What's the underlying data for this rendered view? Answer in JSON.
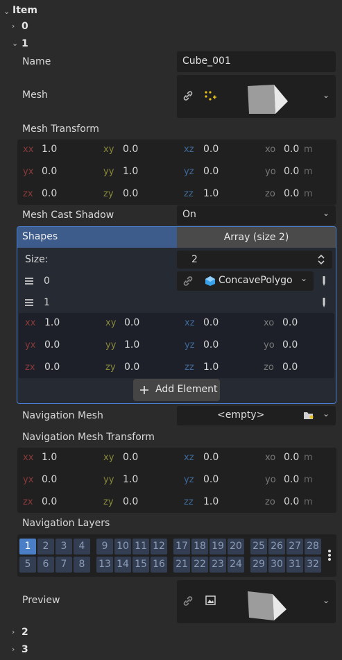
{
  "tree": {
    "item_label": "Item",
    "entries": [
      "0",
      "1",
      "2",
      "3"
    ]
  },
  "name": {
    "label": "Name",
    "value": "Cube_001"
  },
  "mesh": {
    "label": "Mesh"
  },
  "mesh_transform": {
    "label": "Mesh Transform",
    "rows": [
      {
        "a": "xx",
        "av": "1.0",
        "b": "xy",
        "bv": "0.0",
        "c": "xz",
        "cv": "0.0",
        "d": "xo",
        "dv": "0.0",
        "u": "m"
      },
      {
        "a": "yx",
        "av": "0.0",
        "b": "yy",
        "bv": "1.0",
        "c": "yz",
        "cv": "0.0",
        "d": "yo",
        "dv": "0.0",
        "u": "m"
      },
      {
        "a": "zx",
        "av": "0.0",
        "b": "zy",
        "bv": "0.0",
        "c": "zz",
        "cv": "1.0",
        "d": "zo",
        "dv": "0.0",
        "u": "m"
      }
    ]
  },
  "mesh_cast_shadow": {
    "label": "Mesh Cast Shadow",
    "value": "On"
  },
  "shapes": {
    "label": "Shapes",
    "array_label": "Array (size 2)",
    "size_label": "Size:",
    "size_value": "2",
    "element0": {
      "index": "0",
      "type": "ConcavePolygo"
    },
    "element1": {
      "index": "1"
    },
    "rows": [
      {
        "a": "xx",
        "av": "1.0",
        "b": "xy",
        "bv": "0.0",
        "c": "xz",
        "cv": "0.0",
        "d": "xo",
        "dv": "0.0"
      },
      {
        "a": "yx",
        "av": "0.0",
        "b": "yy",
        "bv": "1.0",
        "c": "yz",
        "cv": "0.0",
        "d": "yo",
        "dv": "0.0"
      },
      {
        "a": "zx",
        "av": "0.0",
        "b": "zy",
        "bv": "0.0",
        "c": "zz",
        "cv": "1.0",
        "d": "zo",
        "dv": "0.0"
      }
    ],
    "add_element": "Add Element"
  },
  "navigation_mesh": {
    "label": "Navigation Mesh",
    "value": "<empty>"
  },
  "navigation_mesh_transform": {
    "label": "Navigation Mesh Transform",
    "rows": [
      {
        "a": "xx",
        "av": "1.0",
        "b": "xy",
        "bv": "0.0",
        "c": "xz",
        "cv": "0.0",
        "d": "xo",
        "dv": "0.0",
        "u": "m"
      },
      {
        "a": "yx",
        "av": "0.0",
        "b": "yy",
        "bv": "1.0",
        "c": "yz",
        "cv": "0.0",
        "d": "yo",
        "dv": "0.0",
        "u": "m"
      },
      {
        "a": "zx",
        "av": "0.0",
        "b": "zy",
        "bv": "0.0",
        "c": "zz",
        "cv": "1.0",
        "d": "zo",
        "dv": "0.0",
        "u": "m"
      }
    ]
  },
  "navigation_layers": {
    "label": "Navigation Layers",
    "top": [
      "1",
      "2",
      "3",
      "4",
      "9",
      "10",
      "11",
      "12",
      "17",
      "18",
      "19",
      "20",
      "25",
      "26",
      "27",
      "28"
    ],
    "bottom": [
      "5",
      "6",
      "7",
      "8",
      "13",
      "14",
      "15",
      "16",
      "21",
      "22",
      "23",
      "24",
      "29",
      "30",
      "31",
      "32"
    ],
    "enabled": "1"
  },
  "preview": {
    "label": "Preview"
  },
  "colors": {
    "accent": "#4b7fd1",
    "selected_layer": "#4a7fc7",
    "mesh_icon": "#e8c21a",
    "concave_icon": "#3aa0e8"
  }
}
